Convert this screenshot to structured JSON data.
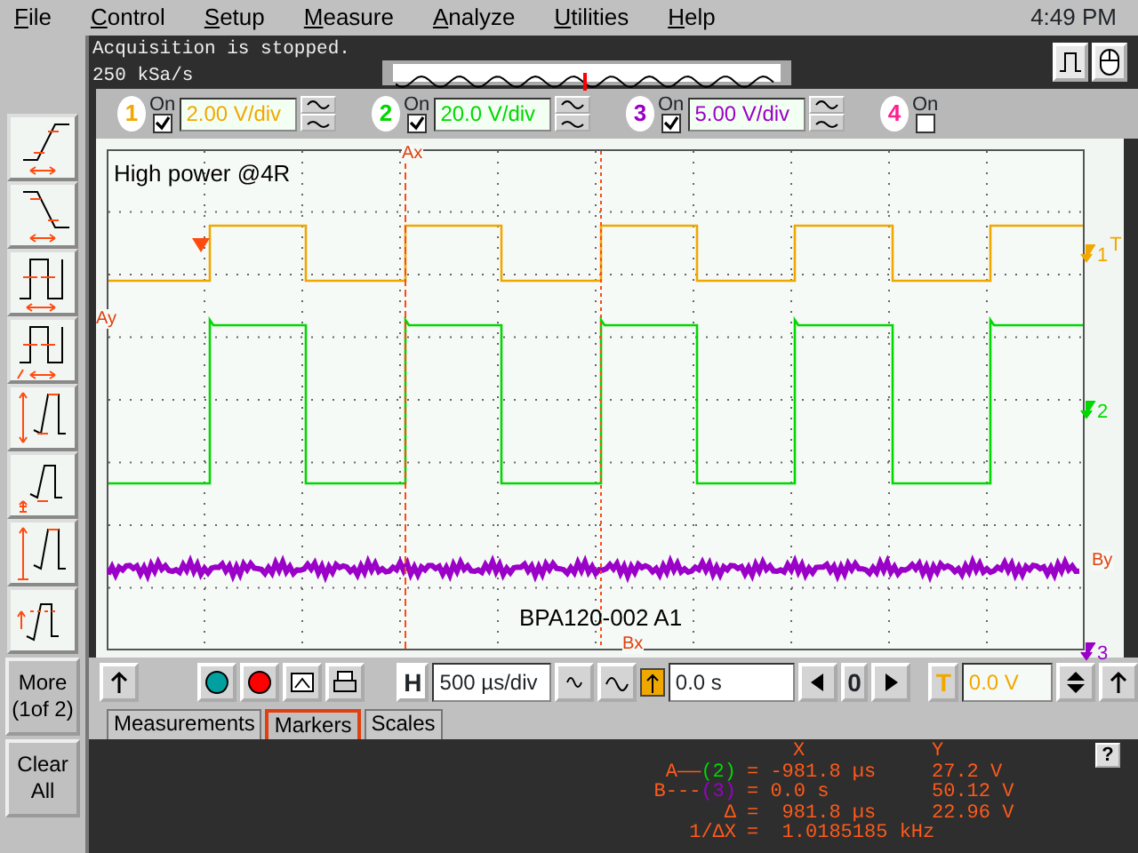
{
  "menu": [
    "File",
    "Control",
    "Setup",
    "Measure",
    "Analyze",
    "Utilities",
    "Help"
  ],
  "clock": "4:49 PM",
  "status": [
    "Acquisition is stopped.",
    "250 kSa/s"
  ],
  "channels": [
    {
      "number": "1",
      "on_label": "On",
      "on": true,
      "scale": "2.00 V/div",
      "color": "#f0a800"
    },
    {
      "number": "2",
      "on_label": "On",
      "on": true,
      "scale": "20.0 V/div",
      "color": "#00d800"
    },
    {
      "number": "3",
      "on_label": "On",
      "on": true,
      "scale": "5.00 V/div",
      "color": "#9a00c8"
    },
    {
      "number": "4",
      "on_label": "On",
      "on": false,
      "color": "#ff2090"
    }
  ],
  "display": {
    "title": "High power @4R",
    "caption": "BPA120-002 A1",
    "markers": [
      {
        "kind": "top",
        "label": "Ax"
      },
      {
        "kind": "left",
        "label": "Ay"
      },
      {
        "kind": "right",
        "label": "By"
      },
      {
        "kind": "bottom",
        "label": "Bx"
      }
    ],
    "level_markers": [
      {
        "channel": "1",
        "tag": "T"
      },
      {
        "channel": "2"
      },
      {
        "channel": "3"
      }
    ]
  },
  "side_buttons": [
    "More (1of 2)",
    "Clear All"
  ],
  "horizontal": {
    "label": "H",
    "scale": "500 µs/div",
    "position": "0.0 s",
    "reference": "0"
  },
  "trigger": {
    "label": "T",
    "level": "0.0 V"
  },
  "tabs": [
    {
      "label": "Measurements",
      "selected": false
    },
    {
      "label": "Markers",
      "selected": true
    },
    {
      "label": "Scales",
      "selected": false
    }
  ],
  "readout": {
    "help": "?",
    "header": [
      "X",
      "Y"
    ],
    "rows": [
      {
        "name": "A——",
        "source": "(2)",
        "color": "#00d800",
        "x": "= -981.8 µs",
        "y": "27.2 V"
      },
      {
        "name": "B---",
        "source": "(3)",
        "color": "#9a00c8",
        "x": "= 0.0 s",
        "y": "50.12 V"
      },
      {
        "name": "Δ",
        "x": "=  981.8 µs",
        "y": "22.96 V"
      },
      {
        "name": "1/ΔX",
        "x": "=  1.0185185 kHz"
      }
    ]
  }
}
